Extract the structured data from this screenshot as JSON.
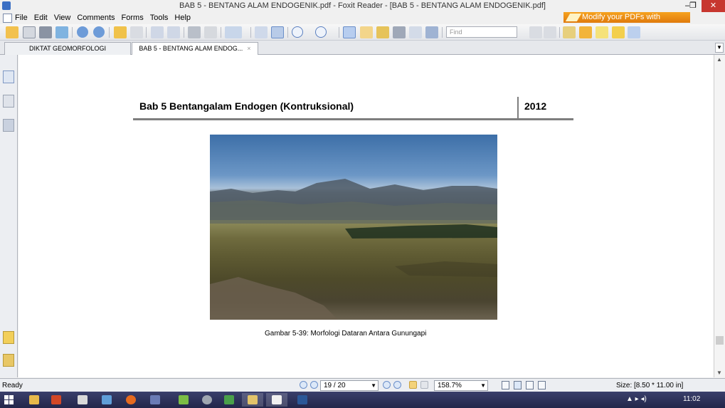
{
  "window": {
    "title": "BAB 5 - BENTANG ALAM ENDOGENIK.pdf - Foxit Reader - [BAB 5 - BENTANG ALAM ENDOGENIK.pdf]",
    "minimize": "–",
    "maximize": "❐",
    "close": "✕"
  },
  "menu": {
    "items": [
      "File",
      "Edit",
      "View",
      "Comments",
      "Forms",
      "Tools",
      "Help"
    ]
  },
  "banner": {
    "text": "Modify your PDFs with Phantom"
  },
  "toolbar": {
    "find_placeholder": "Find"
  },
  "tabs": [
    {
      "label": "DIKTAT GEOMORFOLOGI"
    },
    {
      "label": "BAB 5 - BENTANG ALAM ENDOG...",
      "close": "×"
    }
  ],
  "tab_dropdown": "▼",
  "document": {
    "header_title": "Bab 5 Bentangalam Endogen (Kontruksional)",
    "header_year": "2012",
    "caption": "Gambar 5-39: Morfologi Dataran Antara Gunungapi"
  },
  "scrollbar": {
    "up": "▲",
    "down": "▼"
  },
  "status": {
    "ready": "Ready",
    "page": "19 / 20",
    "zoom": "158.7%",
    "size": "Size: [8.50 * 11.00 in]",
    "dropdown": "▼"
  },
  "taskbar": {
    "tray": "▲  ▸  ◂)",
    "clock": "11:02"
  },
  "colors": {
    "accent": "#3b6fc4",
    "banner": "#f39a1a",
    "close": "#c7372f",
    "taskbar": "#2c2f57"
  }
}
